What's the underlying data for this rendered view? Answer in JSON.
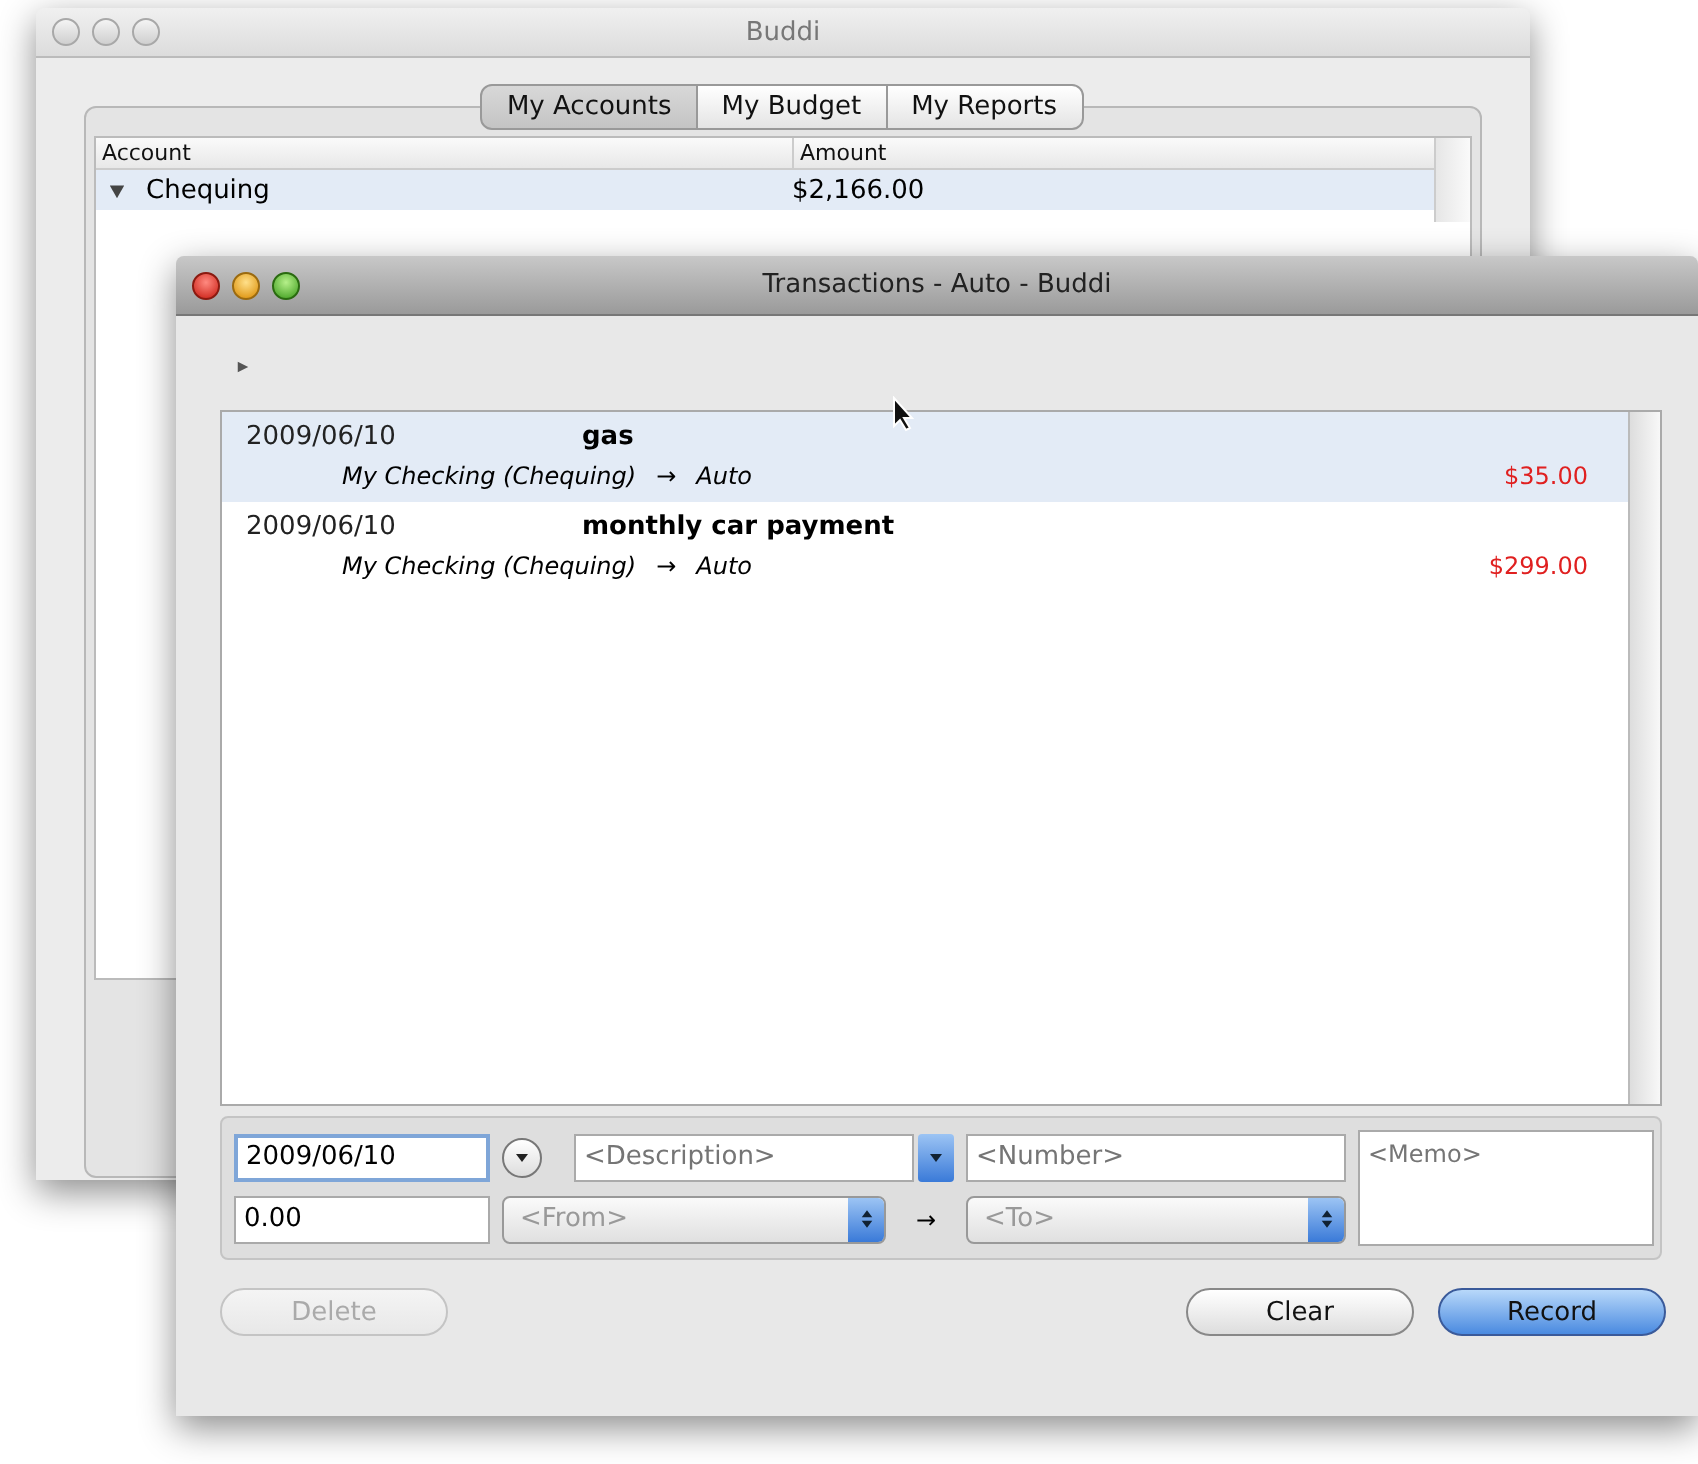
{
  "back_window": {
    "title": "Buddi",
    "tabs": [
      {
        "label": "My Accounts",
        "selected": true
      },
      {
        "label": "My Budget",
        "selected": false
      },
      {
        "label": "My Reports",
        "selected": false
      }
    ],
    "table": {
      "columns": [
        "Account",
        "Amount"
      ],
      "rows": [
        {
          "account": "Chequing",
          "amount": "$2,166.00",
          "expanded": true,
          "selected": true
        }
      ]
    }
  },
  "front_window": {
    "title": "Transactions - Auto - Buddi",
    "transactions": [
      {
        "date": "2009/06/10",
        "description": "gas",
        "from": "My Checking (Chequing)",
        "arrow": "→",
        "to": "Auto",
        "amount": "$35.00",
        "selected": true
      },
      {
        "date": "2009/06/10",
        "description": "monthly car payment",
        "from": "My Checking (Chequing)",
        "arrow": "→",
        "to": "Auto",
        "amount": "$299.00",
        "selected": false
      }
    ],
    "form": {
      "date": "2009/06/10",
      "amount": "0.00",
      "description": {
        "placeholder": "<Description>"
      },
      "number": {
        "placeholder": "<Number>"
      },
      "memo": {
        "placeholder": "<Memo>"
      },
      "from": {
        "placeholder": "<From>"
      },
      "arrow": "→",
      "to": {
        "placeholder": "<To>"
      }
    },
    "buttons": [
      {
        "label": "Delete",
        "kind": "plain",
        "disabled": true
      },
      {
        "label": "Clear",
        "kind": "plain",
        "disabled": false
      },
      {
        "label": "Record",
        "kind": "default",
        "disabled": false
      }
    ]
  }
}
